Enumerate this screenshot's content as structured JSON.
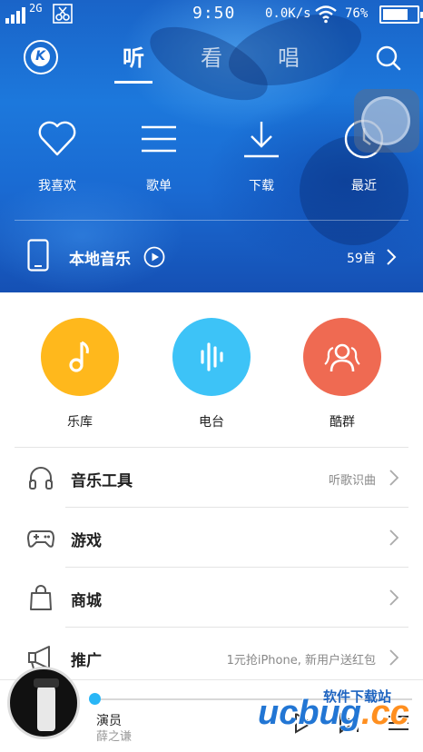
{
  "status_bar": {
    "network": "2G",
    "time": "9:50",
    "speed": "0.0K/s",
    "battery_percent": "76%",
    "battery_level": 0.76
  },
  "nav": {
    "logo_letter": "K",
    "tabs": [
      {
        "label": "听",
        "active": true
      },
      {
        "label": "看",
        "active": false
      },
      {
        "label": "唱",
        "active": false
      }
    ]
  },
  "quick_actions": [
    {
      "label": "我喜欢",
      "icon": "heart-icon"
    },
    {
      "label": "歌单",
      "icon": "list-icon"
    },
    {
      "label": "下载",
      "icon": "download-icon"
    },
    {
      "label": "最近",
      "icon": "clock-icon"
    }
  ],
  "local_music": {
    "label": "本地音乐",
    "count": "59首"
  },
  "circles": [
    {
      "label": "乐库",
      "color": "#ffb81c",
      "icon": "music-note-icon"
    },
    {
      "label": "电台",
      "color": "#3dc3f7",
      "icon": "soundwave-icon"
    },
    {
      "label": "酷群",
      "color": "#ef6a52",
      "icon": "group-icon"
    }
  ],
  "list": [
    {
      "title": "音乐工具",
      "sub": "听歌识曲",
      "icon": "headphones-icon"
    },
    {
      "title": "游戏",
      "sub": "",
      "icon": "gamepad-icon"
    },
    {
      "title": "商城",
      "sub": "",
      "icon": "shopping-bag-icon"
    },
    {
      "title": "推广",
      "sub": "1元抢iPhone, 新用户送红包",
      "icon": "megaphone-icon"
    }
  ],
  "player": {
    "song": "演员",
    "artist": "薛之谦",
    "progress": 0.0
  },
  "watermark": {
    "brand": "ucbug",
    "domain": ".cc",
    "caption": "软件下载站"
  }
}
